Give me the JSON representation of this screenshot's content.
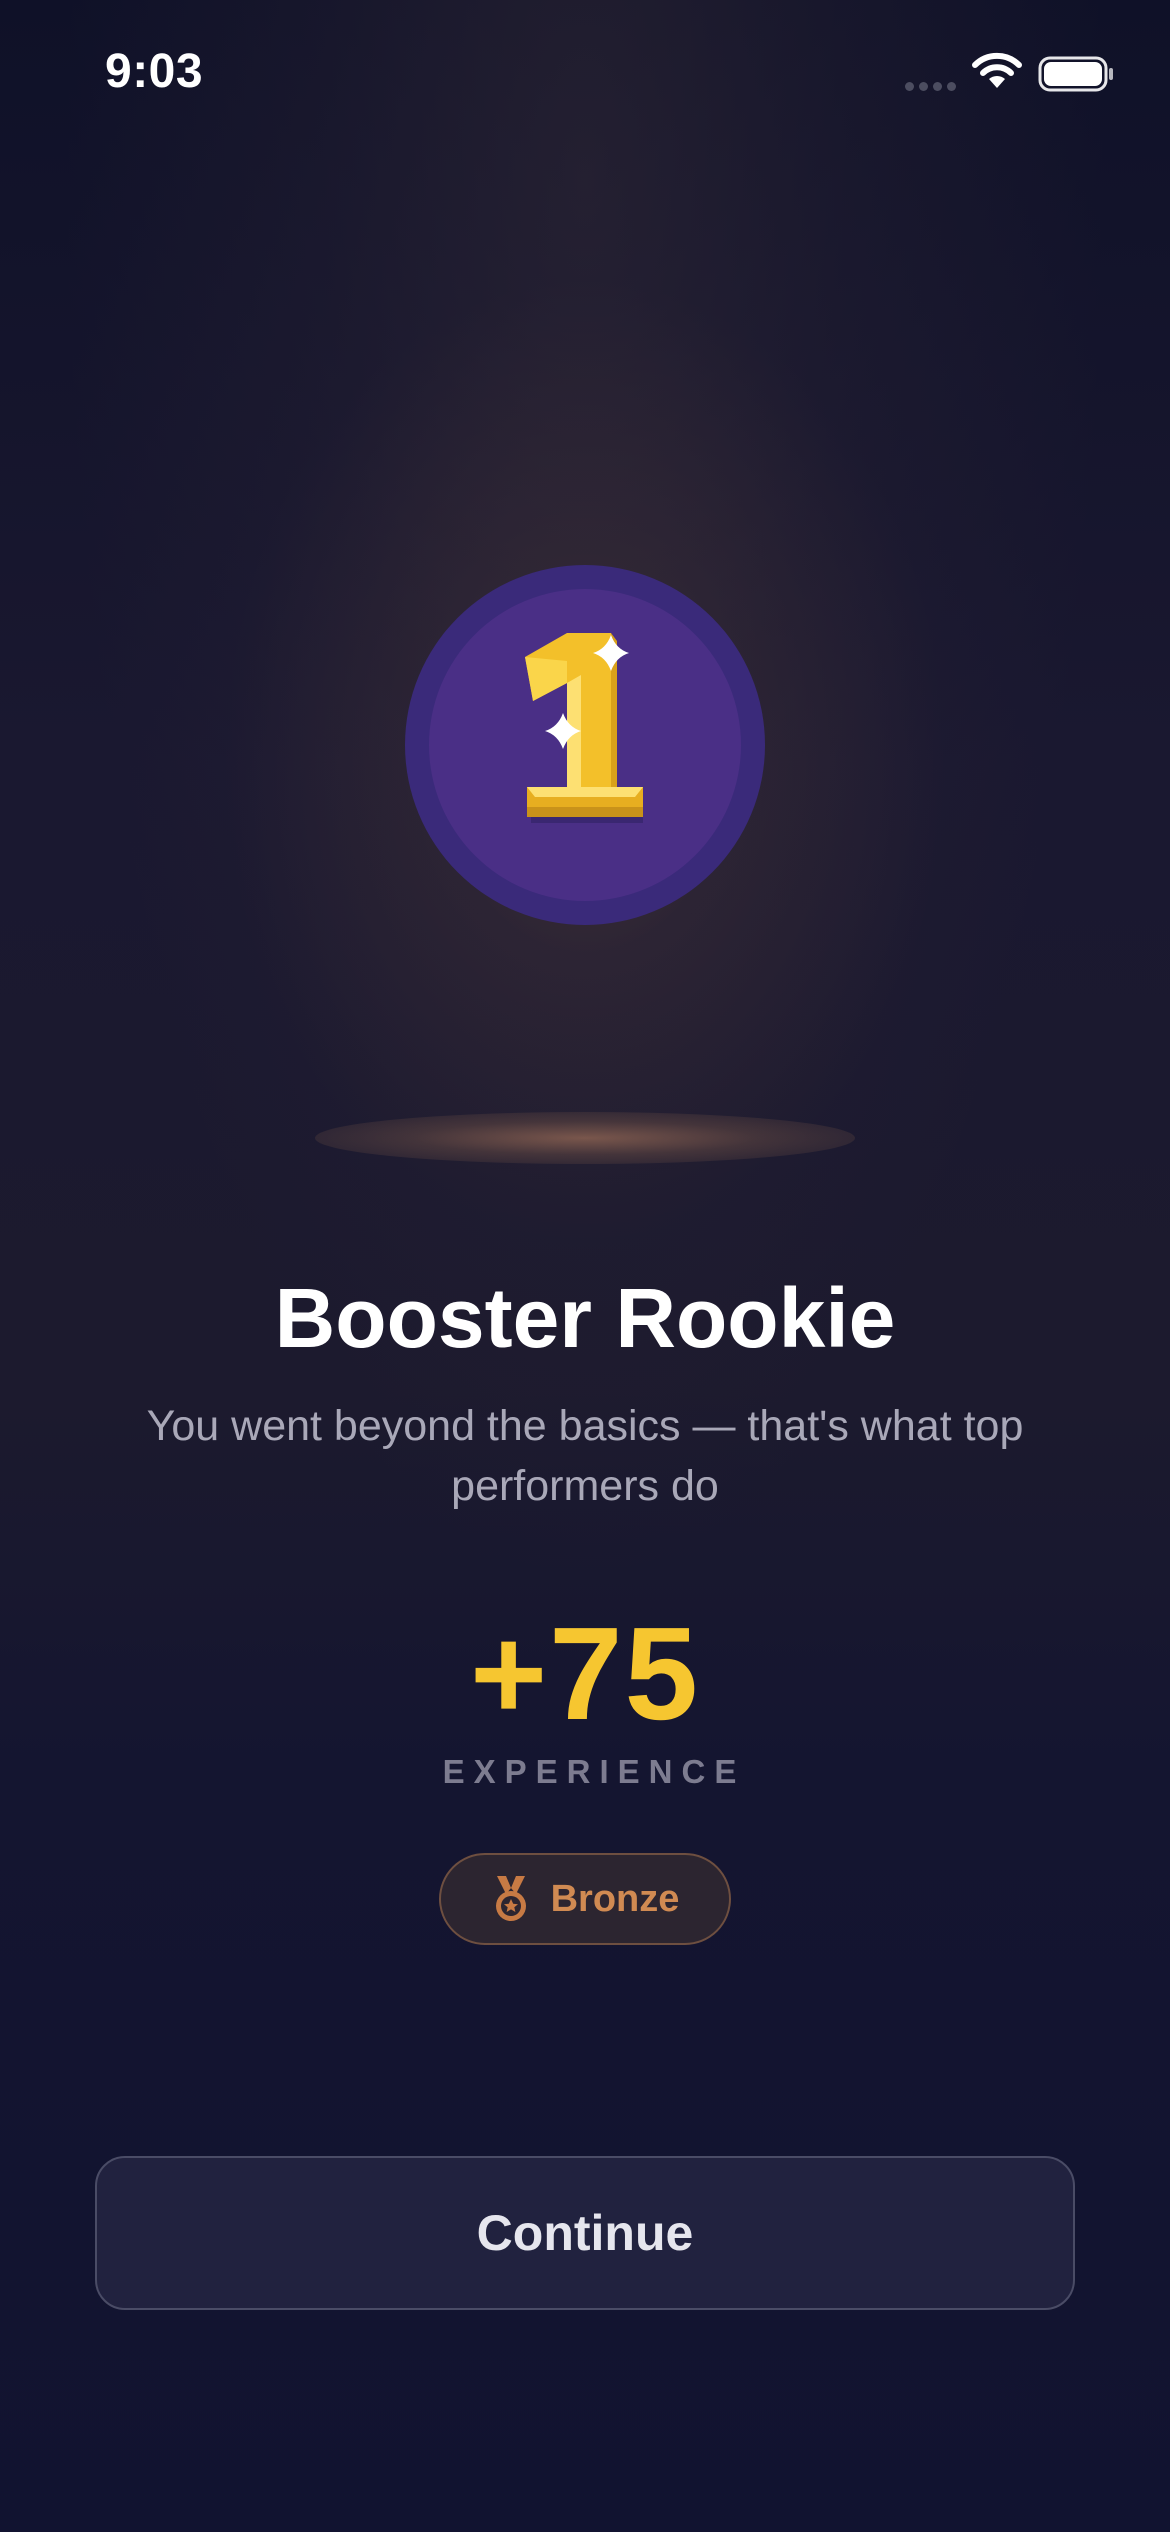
{
  "status_bar": {
    "time": "9:03",
    "signal_icon": "cellular-signal-icon",
    "wifi_icon": "wifi-icon",
    "battery_icon": "battery-icon"
  },
  "achievement": {
    "badge_icon": "number-one-trophy-icon",
    "title": "Booster Rookie",
    "description": "You went beyond the basics — that's what top performers do",
    "xp": "+75",
    "xp_label": "EXPERIENCE",
    "tier": {
      "icon": "bronze-medal-icon",
      "label": "Bronze"
    }
  },
  "actions": {
    "continue_label": "Continue"
  },
  "colors": {
    "background": "#111330",
    "accent_gold": "#f6c630",
    "badge_purple": "#4a2f86",
    "bronze": "#d08a52"
  }
}
